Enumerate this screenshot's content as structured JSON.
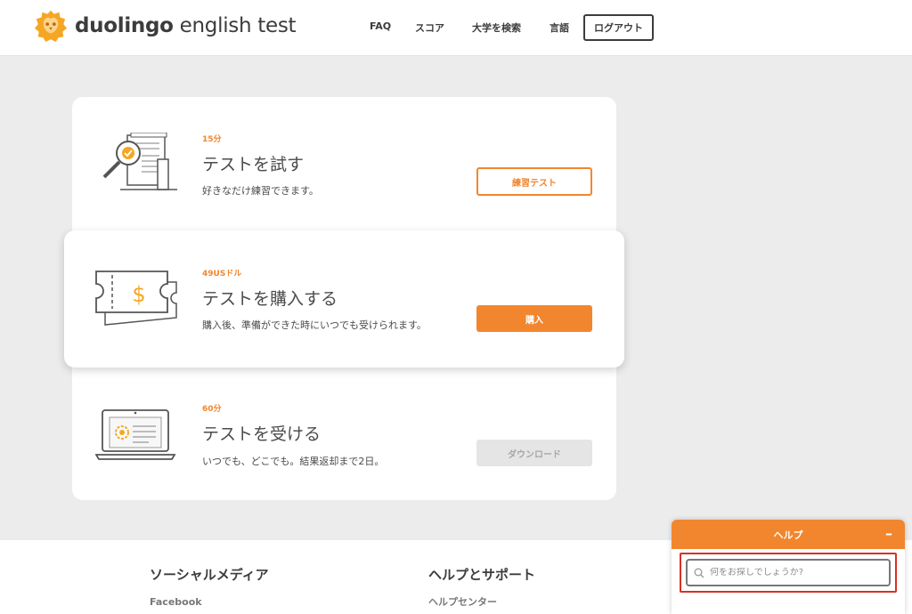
{
  "header": {
    "logo_bold": "duolingo",
    "logo_light": "english test",
    "nav": {
      "faq": "FAQ",
      "score": "スコア",
      "search_university": "大学を検索",
      "language": "言語",
      "logout": "ログアウト"
    }
  },
  "cards": [
    {
      "meta": "15分",
      "title": "テストを試す",
      "description": "好きなだけ練習できます。",
      "button": "練習テスト",
      "icon": "magnifier-document-icon"
    },
    {
      "meta": "49USドル",
      "title": "テストを購入する",
      "description": "購入後、準備ができた時にいつでも受けられます。",
      "button": "購入",
      "icon": "ticket-dollar-icon"
    },
    {
      "meta": "60分",
      "title": "テストを受ける",
      "description": "いつでも、どこでも。結果返却まで2日。",
      "button": "ダウンロード",
      "icon": "laptop-certificate-icon"
    }
  ],
  "footer": {
    "social_heading": "ソーシャルメディア",
    "social_first_link": "Facebook",
    "help_heading": "ヘルプとサポート",
    "help_first_link": "ヘルプセンター"
  },
  "help_widget": {
    "title": "ヘルプ",
    "minimize": "–",
    "search_placeholder": "何をお探しでしょうか?"
  },
  "colors": {
    "accent": "#f2862e",
    "text": "#3c3c3c",
    "background": "#ececec",
    "disabled": "#e5e5e5",
    "focus_outline": "#d93025"
  }
}
